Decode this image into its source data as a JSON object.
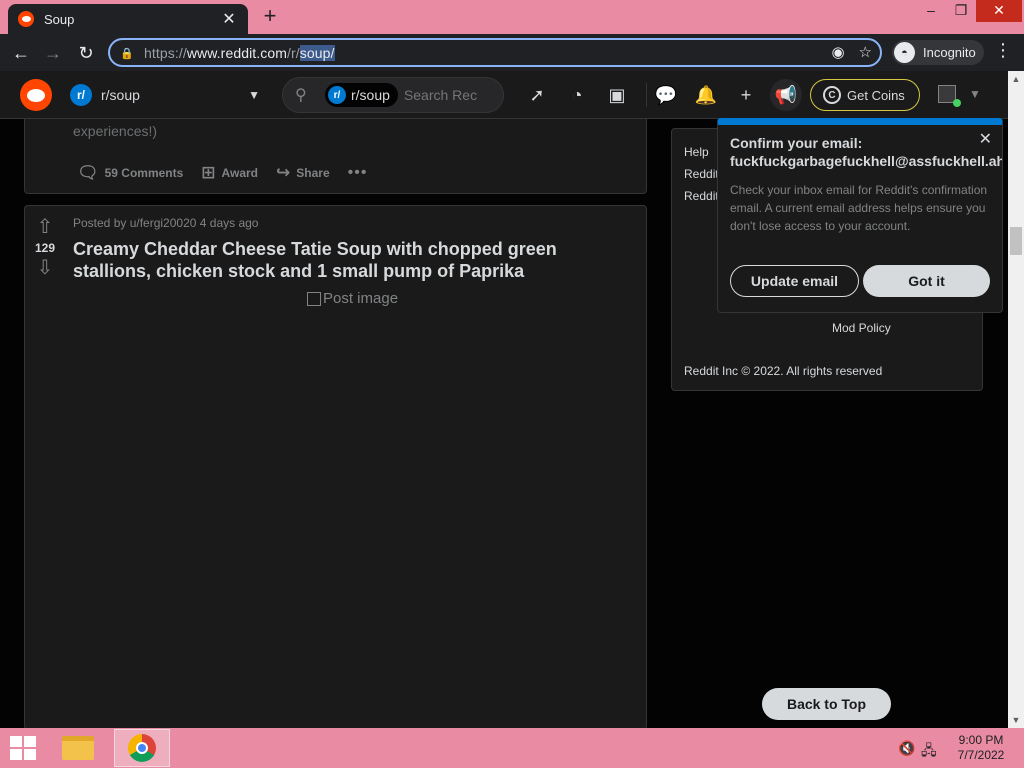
{
  "browser": {
    "tab_title": "Soup",
    "url_scheme": "https://",
    "url_host": "www.reddit.com",
    "url_path_dim": "/r/",
    "url_path_selected": "soup/",
    "incognito_label": "Incognito"
  },
  "header": {
    "community": "r/soup",
    "search_chip": "r/soup",
    "search_placeholder": "Search Rec",
    "coins_label": "Get Coins"
  },
  "prev_post": {
    "clipped_text": "experiences!)",
    "comments": "59 Comments",
    "award": "Award",
    "share": "Share"
  },
  "post": {
    "votes": "129",
    "posted_by": "Posted by u/fergi20020 4 days ago",
    "title": "Creamy Cheddar Cheese Tatie Soup with chopped green stallions, chicken stock and 1 small pump of Paprika",
    "image_alt": "Post image"
  },
  "sidebar": {
    "links": [
      "Help",
      "Reddit",
      "Reddit"
    ],
    "mod_policy": "Mod Policy",
    "copyright": "Reddit Inc © 2022. All rights reserved"
  },
  "popup": {
    "title": "Confirm your email:",
    "email": "fuckfuckgarbagefuckhell@assfuckhell.ahshf",
    "body": "Check your inbox email for Reddit's confirmation email. A current email address helps ensure you don't lose access to your account.",
    "update_label": "Update email",
    "got_it_label": "Got it"
  },
  "back_to_top": "Back to Top",
  "taskbar": {
    "time": "9:00 PM",
    "date": "7/7/2022"
  },
  "colors": {
    "reddit_orange": "#ff4500",
    "reddit_blue": "#0079d3",
    "titlebar_pink": "#e98ba3"
  }
}
